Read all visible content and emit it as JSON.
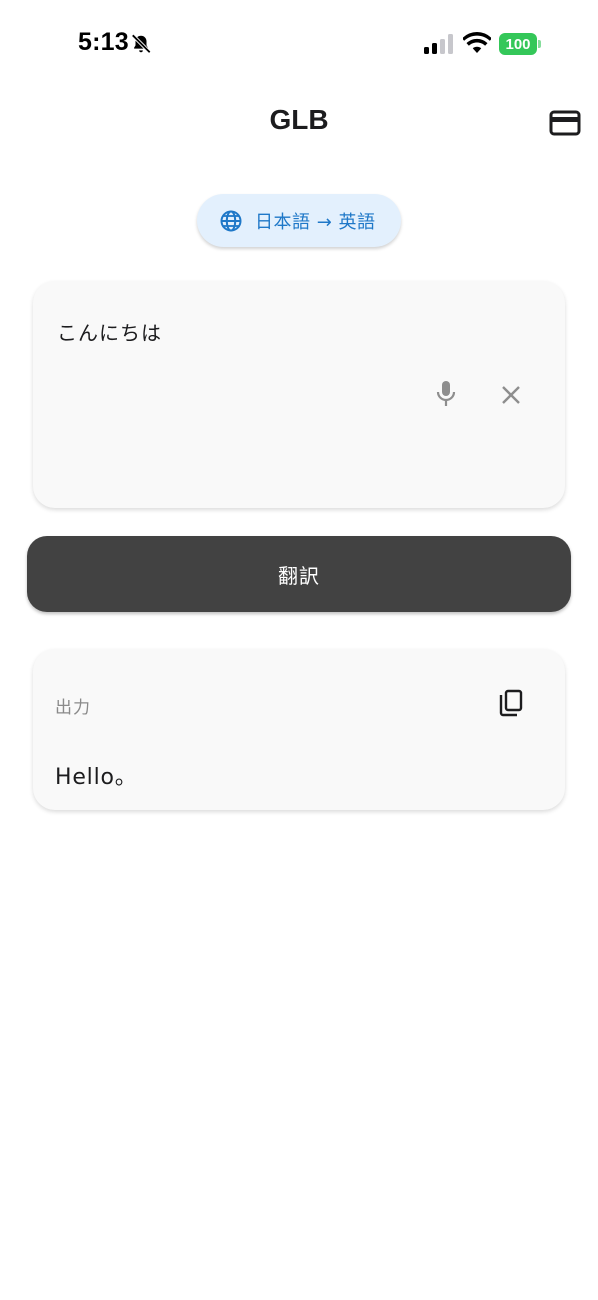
{
  "status_bar": {
    "time": "5:13",
    "battery_level": "100",
    "icons": [
      "bell-slash-icon",
      "cellular-signal-icon",
      "wifi-icon",
      "battery-icon"
    ],
    "battery_color": "#34c759"
  },
  "header": {
    "title": "GLB",
    "right_icon": "credit-card-icon"
  },
  "language_chip": {
    "label": "日本語 → 英語",
    "icon": "globe-icon",
    "background": "#e3f0fd",
    "accent": "#1f78c8"
  },
  "input_card": {
    "value": "こんにちは",
    "icons": [
      "microphone-icon",
      "close-icon"
    ]
  },
  "translate_button": {
    "label": "翻訳",
    "background": "#424242"
  },
  "output_card": {
    "label": "出力",
    "value": "Hello。",
    "icon": "copy-icon"
  }
}
